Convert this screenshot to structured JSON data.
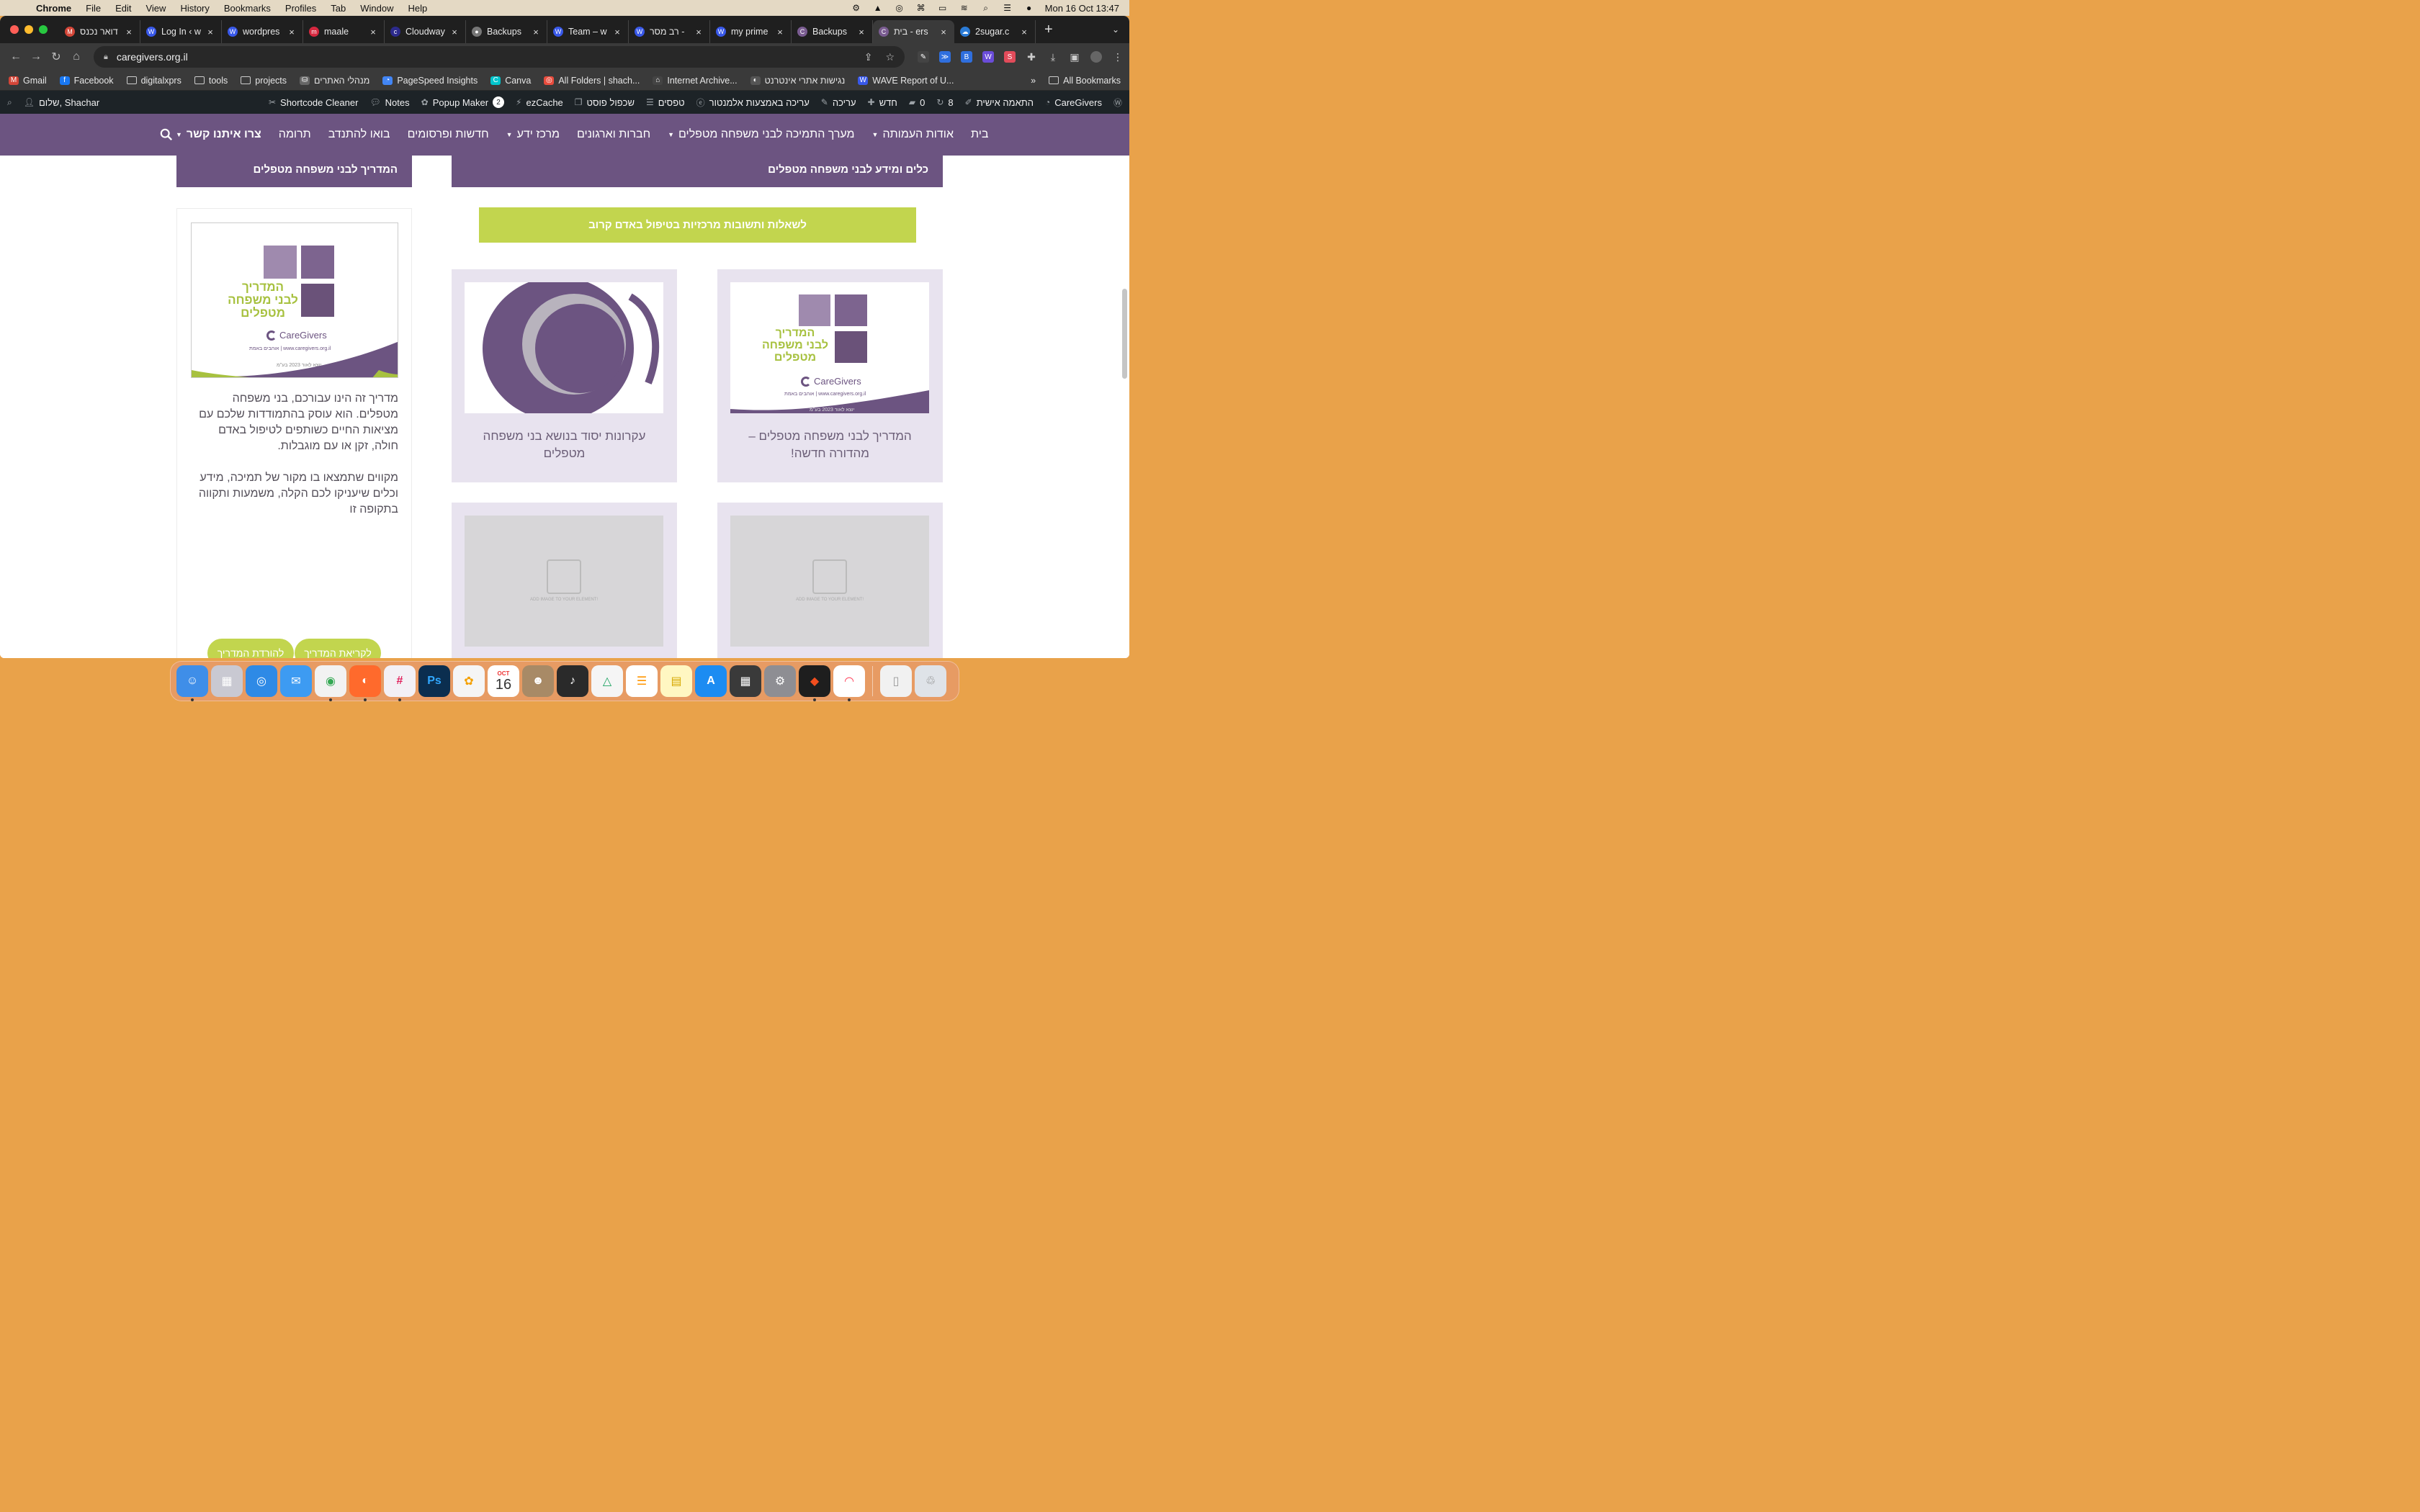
{
  "menubar": {
    "app": "Chrome",
    "items": [
      "File",
      "Edit",
      "View",
      "History",
      "Bookmarks",
      "Profiles",
      "Tab",
      "Window",
      "Help"
    ],
    "clock": "Mon 16 Oct  13:47"
  },
  "tabs": [
    {
      "title": "דואר נכנס",
      "color": "#d44638",
      "glyph": "M"
    },
    {
      "title": "Log In ‹ w",
      "color": "#3858e9",
      "glyph": "W"
    },
    {
      "title": "wordpres",
      "color": "#3858e9",
      "glyph": "W"
    },
    {
      "title": "maale",
      "color": "#d6283f",
      "glyph": "m"
    },
    {
      "title": "Cloudway",
      "color": "#2c2a8c",
      "glyph": "c"
    },
    {
      "title": "Backups",
      "color": "#777777",
      "glyph": "●"
    },
    {
      "title": "Team – w",
      "color": "#3858e9",
      "glyph": "W"
    },
    {
      "title": "רב מסר -",
      "color": "#3858e9",
      "glyph": "W"
    },
    {
      "title": "my prime",
      "color": "#3858e9",
      "glyph": "W"
    },
    {
      "title": "Backups",
      "color": "#7a5c91",
      "glyph": "C"
    },
    {
      "title": "בית - ers",
      "color": "#7a5c91",
      "glyph": "C",
      "active": true
    },
    {
      "title": "2sugar.c",
      "color": "#2b7bd6",
      "glyph": "☁"
    }
  ],
  "toolbar": {
    "url": "caregivers.org.il"
  },
  "bookmarks": [
    {
      "label": "Gmail",
      "type": "icon",
      "color": "#d44638",
      "glyph": "M"
    },
    {
      "label": "Facebook",
      "type": "icon",
      "color": "#1877f2",
      "glyph": "f"
    },
    {
      "label": "digitalxprs",
      "type": "folder"
    },
    {
      "label": "tools",
      "type": "folder"
    },
    {
      "label": "projects",
      "type": "folder"
    },
    {
      "label": "מנהלי האתרים",
      "type": "icon",
      "color": "#666666",
      "glyph": "⛁"
    },
    {
      "label": "PageSpeed Insights",
      "type": "icon",
      "color": "#4285f4",
      "glyph": "◔"
    },
    {
      "label": "Canva",
      "type": "icon",
      "color": "#00c4cc",
      "glyph": "C"
    },
    {
      "label": "All Folders | shach...",
      "type": "icon",
      "color": "#e84c3d",
      "glyph": "◎"
    },
    {
      "label": "Internet Archive...",
      "type": "icon",
      "color": "#444444",
      "glyph": "⌂"
    },
    {
      "label": "נגישות אתרי אינטרנט",
      "type": "icon",
      "color": "#555555",
      "glyph": "◐"
    },
    {
      "label": "WAVE Report of U...",
      "type": "icon",
      "color": "#3858e9",
      "glyph": "W"
    }
  ],
  "bookmarks_more": "»",
  "bookmarks_all": "All Bookmarks",
  "wpbar": {
    "greeting": "שלום, Shachar",
    "left_items": [
      "טפסים",
      "שכפול פוסט",
      "ezCache",
      "Popup Maker",
      "Notes",
      "Shortcode Cleaner"
    ],
    "popup_badge": "2",
    "right_items": [
      "עריכה באמצעות אלמנטור",
      "עריכה",
      "חדש",
      "0",
      "8",
      "התאמה אישית",
      "CareGivers"
    ]
  },
  "nav": {
    "items": [
      "בית",
      "אודות העמותה",
      "מערך התמיכה לבני משפחה מטפלים",
      "חברות וארגונים",
      "מרכז ידע",
      "חדשות ופרסומים",
      "בואו להתנדב",
      "תרומה",
      "צרו איתנו קשר"
    ],
    "dropdowns": [
      1,
      2,
      4,
      8
    ],
    "bold": [
      8
    ]
  },
  "content": {
    "section_header_main": "כלים ומידע לבני משפחה מטפלים",
    "section_header_side": "המדריך לבני משפחה מטפלים",
    "cta_button": "לשאלות ותשובות מרכזיות בטיפול באדם קרוב",
    "cards": [
      {
        "title": "המדריך לבני משפחה מטפלים – מהדורה חדשה!"
      },
      {
        "title": "עקרונות יסוד בנושא בני משפחה מטפלים"
      }
    ],
    "placeholder_text": "ADD IMAGE TO YOUR ELEMENT!",
    "cover": {
      "title_line1": "המדריך",
      "title_line2": "לבני משפחה",
      "title_line3": "מטפלים",
      "logo": "CareGivers",
      "url_line": "www.caregivers.org.il | אוהבים באמת",
      "small_print": "יוצא לאור 2023 בע\"מ"
    },
    "sidebar_para1": "מדריך זה הינו עבורכם, בני משפחה מטפלים. הוא עוסק בהתמודדות שלכם עם מציאות החיים כשותפים לטיפול באדם חולה, זקן או עם מוגבלות.",
    "sidebar_para2": "מקווים שתמצאו בו מקור של תמיכה, מידע וכלים שיעניקו לכם הקלה, משמעות ותקווה בתקופה זו",
    "btn_read": "לקריאת המדריך",
    "btn_download": "להורדת המדריך"
  },
  "dock": {
    "calendar_month": "OCT",
    "calendar_day": "16",
    "apps": [
      {
        "name": "finder-icon",
        "color": "#3f8ee8"
      },
      {
        "name": "launchpad-icon",
        "color": "#c9c9d2"
      },
      {
        "name": "safari-icon",
        "color": "#2e8ae6"
      },
      {
        "name": "mail-icon",
        "color": "#3d9bf2"
      },
      {
        "name": "chrome-icon",
        "color": "#f2f2f2"
      },
      {
        "name": "firefox-icon",
        "color": "#ff6a2c"
      },
      {
        "name": "slack-icon",
        "color": "#f3f0f5"
      },
      {
        "name": "photoshop-icon",
        "color": "#0b2e4f"
      },
      {
        "name": "photos-icon",
        "color": "#f5f5f5"
      },
      {
        "name": "calendar-icon",
        "color": "#ffffff"
      },
      {
        "name": "contacts-icon",
        "color": "#a88a66"
      },
      {
        "name": "garageband-icon",
        "color": "#2a2a2a"
      },
      {
        "name": "drive-icon",
        "color": "#f5f5f5"
      },
      {
        "name": "reminders-icon",
        "color": "#ffffff"
      },
      {
        "name": "notes-icon",
        "color": "#fff7c2"
      },
      {
        "name": "appstore-icon",
        "color": "#1c8cf2"
      },
      {
        "name": "calculator-icon",
        "color": "#3a3a3a"
      },
      {
        "name": "settings-icon",
        "color": "#8e8e93"
      },
      {
        "name": "figma-icon",
        "color": "#1e1e1e"
      },
      {
        "name": "monday-icon",
        "color": "#ffffff"
      },
      {
        "name": "files-icon",
        "color": "#f1f1f1"
      },
      {
        "name": "trash-icon",
        "color": "#dfe3e8"
      }
    ]
  }
}
